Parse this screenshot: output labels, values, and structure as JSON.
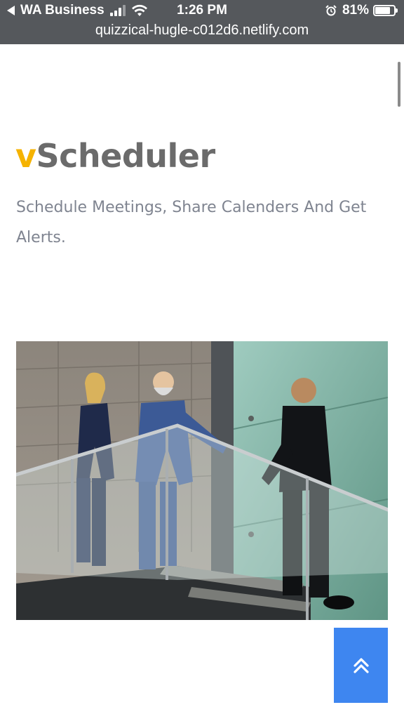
{
  "status_bar": {
    "back_app": "WA Business",
    "time": "1:26 PM",
    "battery": "81%",
    "battery_level": 0.81
  },
  "browser": {
    "url": "quizzical-hugle-c012d6.netlify.com"
  },
  "brand": {
    "prefix": "v",
    "name": "Scheduler",
    "accent_color": "#f5b300"
  },
  "hero": {
    "tagline": "Schedule Meetings, Share Calenders And Get Alerts.",
    "image_icon": "business-people-meeting-photo"
  },
  "back_to_top": {
    "icon": "double-chevron-up-icon",
    "color": "#3e86f0"
  }
}
